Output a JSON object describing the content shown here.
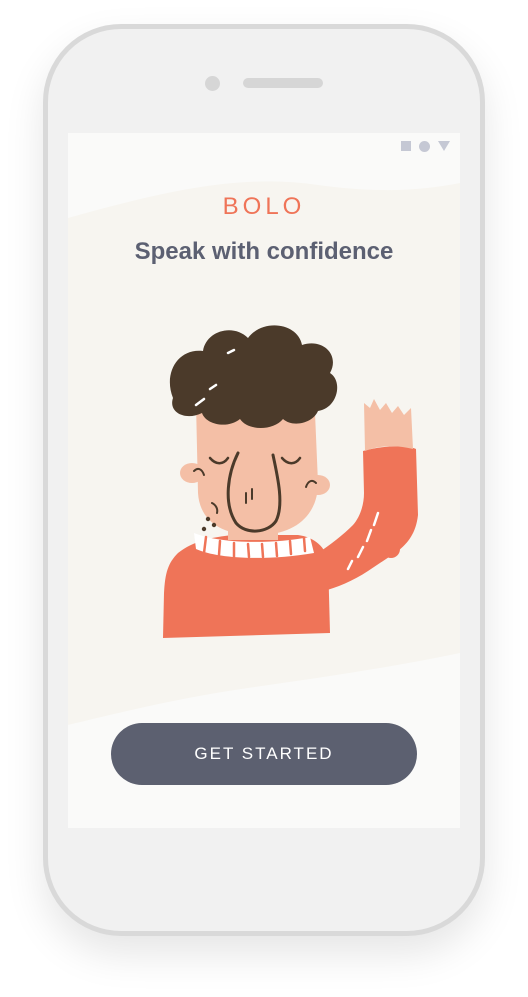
{
  "status_bar": {
    "icons": [
      "square-icon",
      "circle-icon",
      "triangle-icon"
    ]
  },
  "onboarding": {
    "brand": "BOLO",
    "tagline": "Speak with confidence",
    "cta_label": "GET STARTED"
  },
  "colors": {
    "brand": "#ef7458",
    "tagline": "#5c6072",
    "button": "#5c6070",
    "skin": "#f4bfa6",
    "hair": "#4b3a2a",
    "sweater": "#ef7458"
  }
}
